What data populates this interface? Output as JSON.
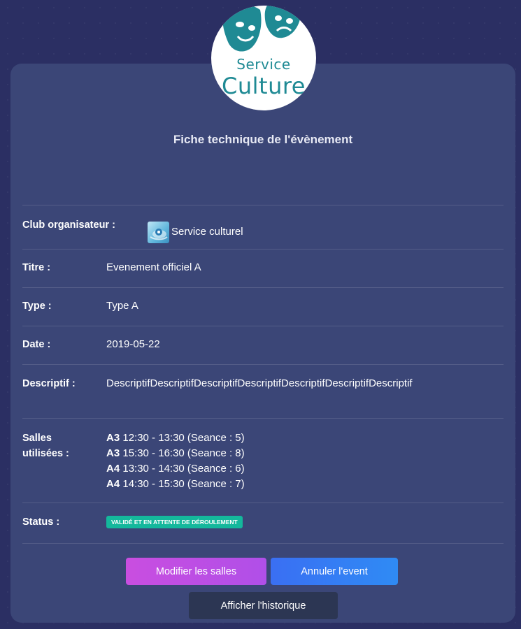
{
  "logo": {
    "line1": "Service",
    "line2": "Culture"
  },
  "title": "Fiche technique de l'évènement",
  "club": {
    "label": "Club organisateur :",
    "value": "Service culturel"
  },
  "titre": {
    "label": "Titre :",
    "value": "Evenement officiel A"
  },
  "type": {
    "label": "Type :",
    "value": "Type A"
  },
  "date": {
    "label": "Date :",
    "value": "2019-05-22"
  },
  "descriptif": {
    "label": "Descriptif :",
    "value": "DescriptifDescriptifDescriptifDescriptifDescriptifDescriptifDescriptif"
  },
  "salles": {
    "label_line1": "Salles",
    "label_line2": "utilisées :",
    "items": [
      {
        "room": "A3",
        "detail": " 12:30 - 13:30 (Seance : 5)"
      },
      {
        "room": "A3",
        "detail": " 15:30 - 16:30 (Seance : 8)"
      },
      {
        "room": "A4",
        "detail": " 13:30 - 14:30 (Seance : 6)"
      },
      {
        "room": "A4",
        "detail": " 14:30 - 15:30 (Seance : 7)"
      }
    ]
  },
  "status": {
    "label": "Status :",
    "badge": "Validé et en attente de déroulement"
  },
  "buttons": {
    "modify": "Modifier les salles",
    "cancel": "Annuler l'event",
    "history": "Afficher l'historique"
  },
  "colors": {
    "background": "#2b2f63",
    "card": "#3b4677",
    "badge": "#14b89c",
    "modify_button": "#c94ee0",
    "cancel_button": "#3a6ff3",
    "history_button": "#2c3653",
    "logo_teal": "#1f8a94"
  },
  "icons": {
    "logo": "theatre-masks-icon",
    "club_avatar": "club-avatar-image"
  }
}
